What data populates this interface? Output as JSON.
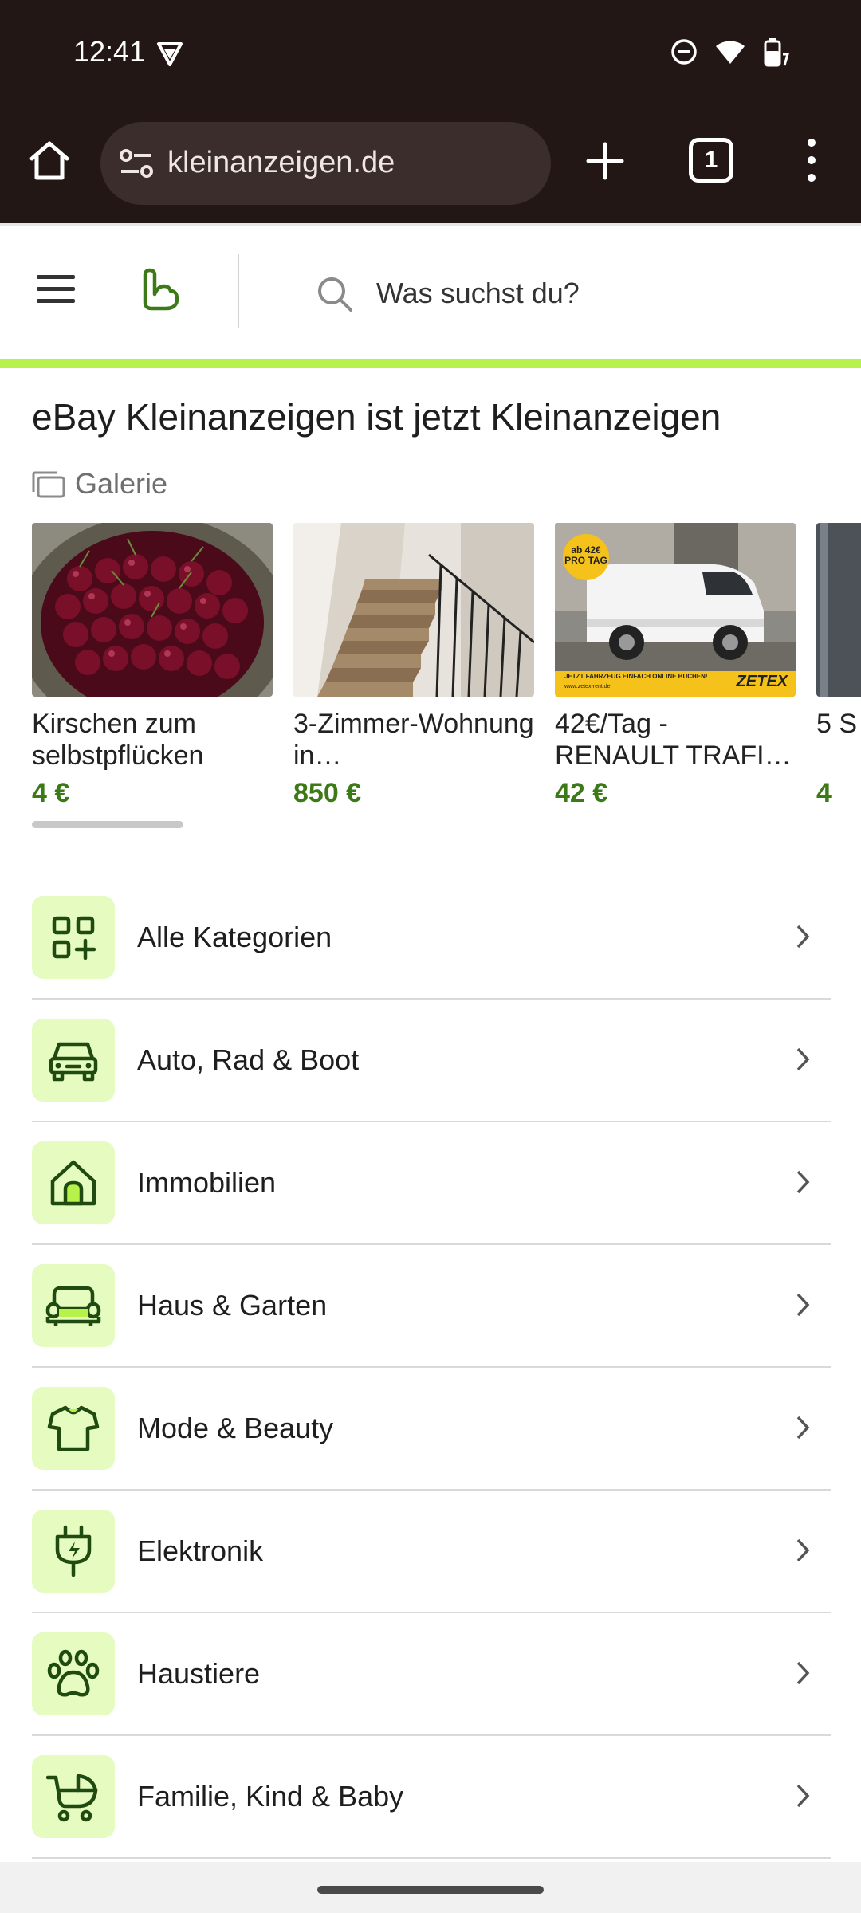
{
  "status": {
    "time": "12:41"
  },
  "browser": {
    "url": "kleinanzeigen.de",
    "tab_count": "1"
  },
  "site": {
    "search_placeholder": "Was suchst du?"
  },
  "headline": "eBay Kleinanzeigen ist jetzt Kleinanzeigen",
  "gallery_label": "Galerie",
  "listings": [
    {
      "title": "Kirschen zum selbstpflücken",
      "price": "4 €"
    },
    {
      "title": "3-Zimmer-Wohnung in…",
      "price": "850 €"
    },
    {
      "title": "42€/Tag - RENAULT TRAFI…",
      "price": "42 €",
      "ad_badge": "ab 42€ PRO TAG",
      "ad_brand": "ZETEX",
      "ad_banner": "JETZT FAHRZEUG EINFACH ONLINE BUCHEN!",
      "ad_url": "www.zetex-rent.de"
    },
    {
      "title": "5 S",
      "price": "4"
    }
  ],
  "categories": [
    {
      "label": "Alle Kategorien",
      "icon": "grid-plus-icon"
    },
    {
      "label": "Auto, Rad & Boot",
      "icon": "car-icon"
    },
    {
      "label": "Immobilien",
      "icon": "house-icon"
    },
    {
      "label": "Haus & Garten",
      "icon": "sofa-icon"
    },
    {
      "label": "Mode & Beauty",
      "icon": "shirt-icon"
    },
    {
      "label": "Elektronik",
      "icon": "plug-icon"
    },
    {
      "label": "Haustiere",
      "icon": "paw-icon"
    },
    {
      "label": "Familie, Kind & Baby",
      "icon": "stroller-icon"
    }
  ],
  "colors": {
    "accent_green": "#3c7a17",
    "brand_lime": "#b6f24a",
    "category_bg": "#e5fbbf",
    "browser_bg": "#231716"
  }
}
